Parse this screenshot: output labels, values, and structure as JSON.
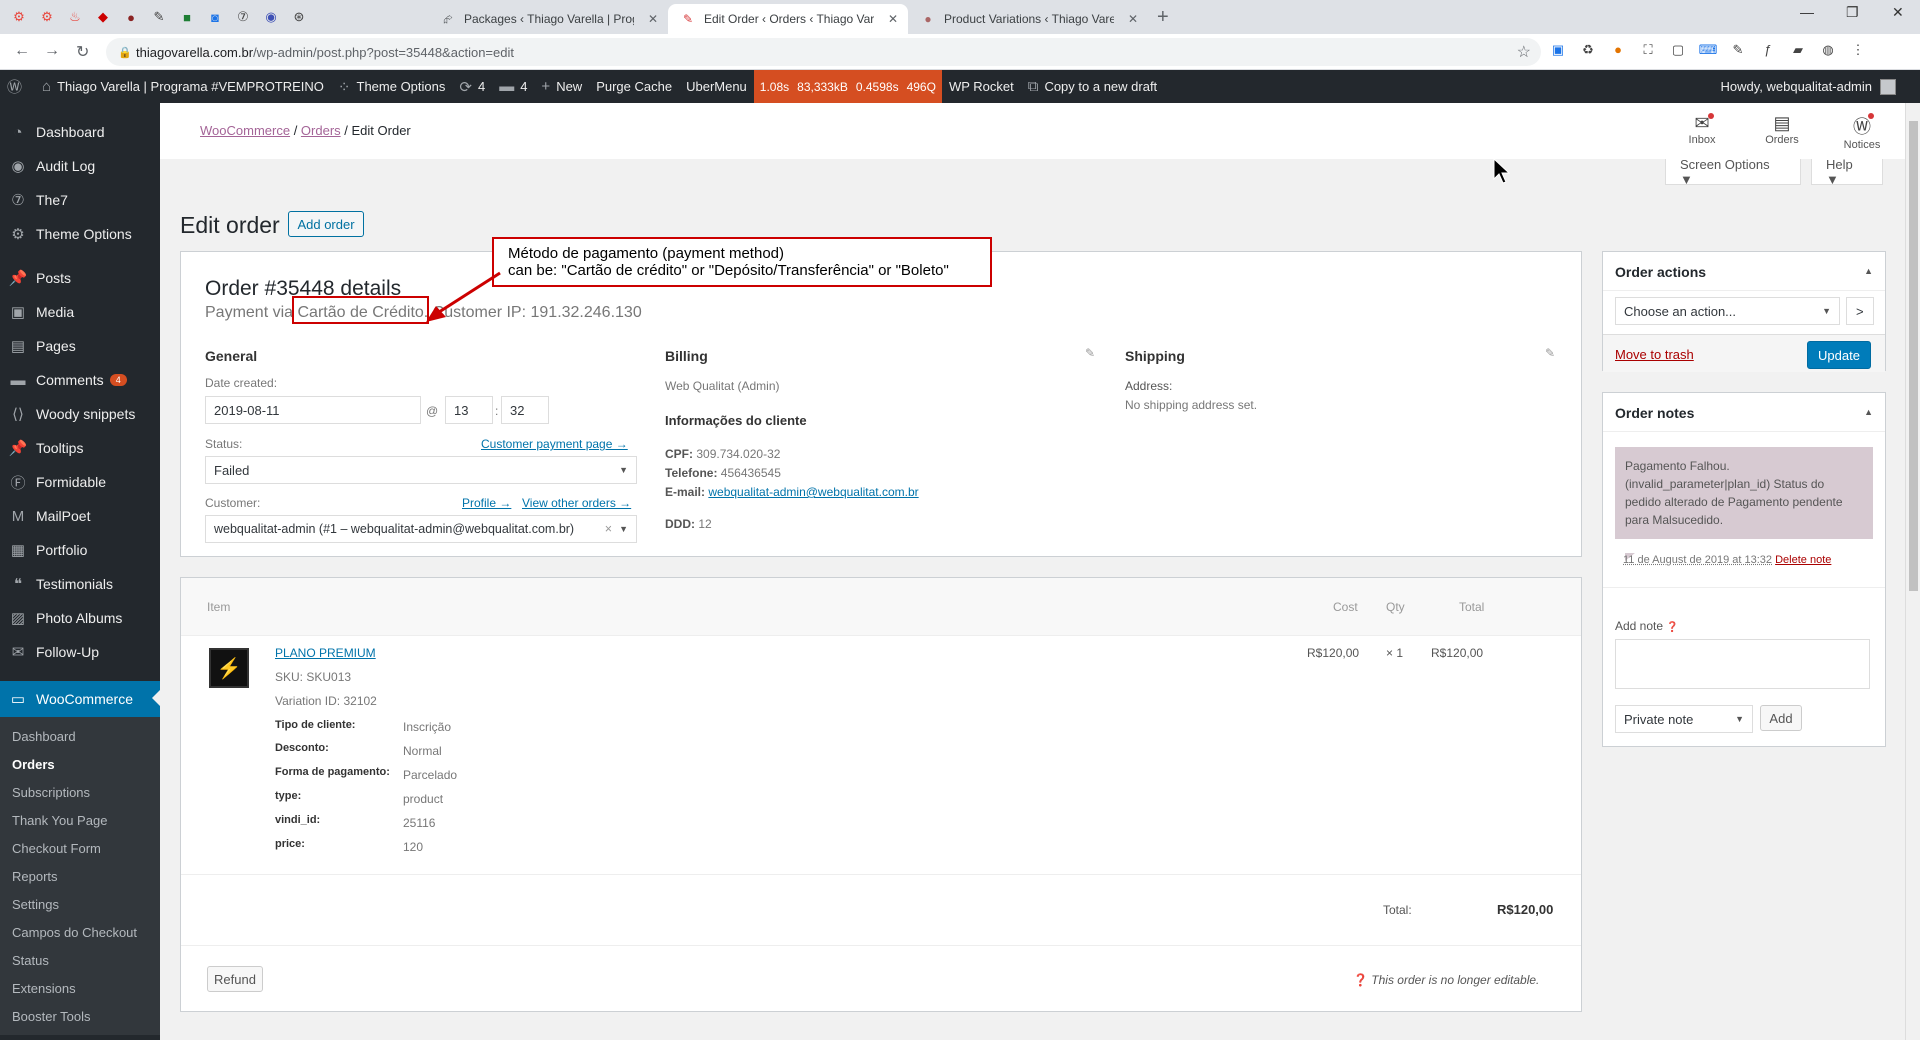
{
  "browser": {
    "tabs": [
      {
        "title": "Packages ‹ Thiago Varella | Progr",
        "active": false
      },
      {
        "title": "Edit Order ‹ Orders ‹ Thiago Vare",
        "active": true
      },
      {
        "title": "Product Variations ‹ Thiago Varel",
        "active": false
      }
    ],
    "url_domain": "thiagovarella.com.br",
    "url_path": "/wp-admin/post.php?post=35448&action=edit"
  },
  "adminbar": {
    "site_name": "Thiago Varella | Programa #VEMPROTREINO",
    "theme_options": "Theme Options",
    "updates_count": "4",
    "comments_count": "4",
    "new_label": "New",
    "purge_cache": "Purge Cache",
    "ubermenu": "UberMenu",
    "perf": [
      "1.08s",
      "83,333kB",
      "0.4598s",
      "496Q"
    ],
    "wp_rocket": "WP Rocket",
    "copy_draft": "Copy to a new draft",
    "howdy": "Howdy, webqualitat-admin"
  },
  "sidebar": {
    "items": [
      {
        "label": "Dashboard",
        "icon": "dashboard-icon"
      },
      {
        "label": "Audit Log",
        "icon": "audit-icon"
      },
      {
        "label": "The7",
        "icon": "the7-icon"
      },
      {
        "label": "Theme Options",
        "icon": "gear-icon"
      },
      {
        "label": "Posts",
        "icon": "pin-icon"
      },
      {
        "label": "Media",
        "icon": "media-icon"
      },
      {
        "label": "Pages",
        "icon": "page-icon"
      },
      {
        "label": "Comments",
        "icon": "comment-icon",
        "badge": "4"
      },
      {
        "label": "Woody snippets",
        "icon": "snippet-icon"
      },
      {
        "label": "Tooltips",
        "icon": "pin-icon"
      },
      {
        "label": "Formidable",
        "icon": "formidable-icon"
      },
      {
        "label": "MailPoet",
        "icon": "mailpoet-icon"
      },
      {
        "label": "Portfolio",
        "icon": "portfolio-icon"
      },
      {
        "label": "Testimonials",
        "icon": "testimonial-icon"
      },
      {
        "label": "Photo Albums",
        "icon": "album-icon"
      },
      {
        "label": "Follow-Up",
        "icon": "mail-icon"
      },
      {
        "label": "WooCommerce",
        "icon": "woo-icon"
      }
    ],
    "submenu": [
      "Dashboard",
      "Orders",
      "Subscriptions",
      "Thank You Page",
      "Checkout Form",
      "Reports",
      "Settings",
      "Campos do Checkout",
      "Status",
      "Extensions",
      "Booster Tools"
    ]
  },
  "header": {
    "breadcrumb": {
      "woocommerce": "WooCommerce",
      "orders": "Orders",
      "current": "Edit Order"
    },
    "actions": [
      {
        "label": "Inbox"
      },
      {
        "label": "Orders"
      },
      {
        "label": "Notices"
      }
    ],
    "screen_options": "Screen Options ▼",
    "help": "Help ▼"
  },
  "page": {
    "title": "Edit order",
    "add_order": "Add order"
  },
  "order": {
    "heading": "Order #35448 details",
    "payment_prefix": "Payment via",
    "payment_method": "Cartão de Crédito.",
    "customer_ip": "Customer IP: 191.32.246.130",
    "general": {
      "title": "General",
      "date_label": "Date created:",
      "date": "2019-08-11",
      "at": "@",
      "hour": "13",
      "colon": ":",
      "minute": "32",
      "status_label": "Status:",
      "customer_payment_page": "Customer payment page →",
      "status": "Failed",
      "customer_label": "Customer:",
      "profile": "Profile →",
      "view_other_orders": "View other orders →",
      "customer": "webqualitat-admin (#1 – webqualitat-admin@webqualitat.com.br)",
      "clear": "×"
    },
    "billing": {
      "title": "Billing",
      "name": "Web Qualitat (Admin)",
      "info_title": "Informações do cliente",
      "cpf_label": "CPF:",
      "cpf": "309.734.020-32",
      "phone_label": "Telefone:",
      "phone": "456436545",
      "email_label": "E-mail:",
      "email": "webqualitat-admin@webqualitat.com.br",
      "ddd_label": "DDD:",
      "ddd": "12"
    },
    "shipping": {
      "title": "Shipping",
      "address_label": "Address:",
      "address": "No shipping address set."
    }
  },
  "items": {
    "headers": {
      "item": "Item",
      "cost": "Cost",
      "qty": "Qty",
      "total": "Total"
    },
    "product": {
      "name": "PLANO PREMIUM",
      "sku": "SKU: SKU013",
      "variation": "Variation ID: 32102",
      "cost": "R$120,00",
      "qty": "× 1",
      "total": "R$120,00",
      "meta": [
        {
          "k": "Tipo de cliente:",
          "v": "Inscrição"
        },
        {
          "k": "Desconto:",
          "v": "Normal"
        },
        {
          "k": "Forma de pagamento:",
          "v": "Parcelado"
        },
        {
          "k": "type:",
          "v": "product"
        },
        {
          "k": "vindi_id:",
          "v": "25116"
        },
        {
          "k": "price:",
          "v": "120"
        }
      ]
    },
    "total_label": "Total:",
    "total_value": "R$120,00",
    "refund": "Refund",
    "not_editable": "This order is no longer editable."
  },
  "order_actions": {
    "title": "Order actions",
    "choose": "Choose an action...",
    "go": ">",
    "trash": "Move to trash",
    "update": "Update"
  },
  "order_notes": {
    "title": "Order notes",
    "note": "Pagamento Falhou. (invalid_parameter|plan_id) Status do pedido alterado de Pagamento pendente para Malsucedido.",
    "date": "11 de August de 2019 at 13:32",
    "delete": "Delete note",
    "add_label": "Add note",
    "type": "Private note",
    "add_btn": "Add"
  },
  "annotation": {
    "line1": "Método de pagamento (payment method)",
    "line2": "can be: \"Cartão de crédito\" or \"Depósito/Transferência\" or \"Boleto\""
  },
  "colors": {
    "wp_dark": "#23282d",
    "wp_blue": "#0073aa",
    "woo_purple": "#a46497",
    "annotation_red": "#cc0000"
  }
}
